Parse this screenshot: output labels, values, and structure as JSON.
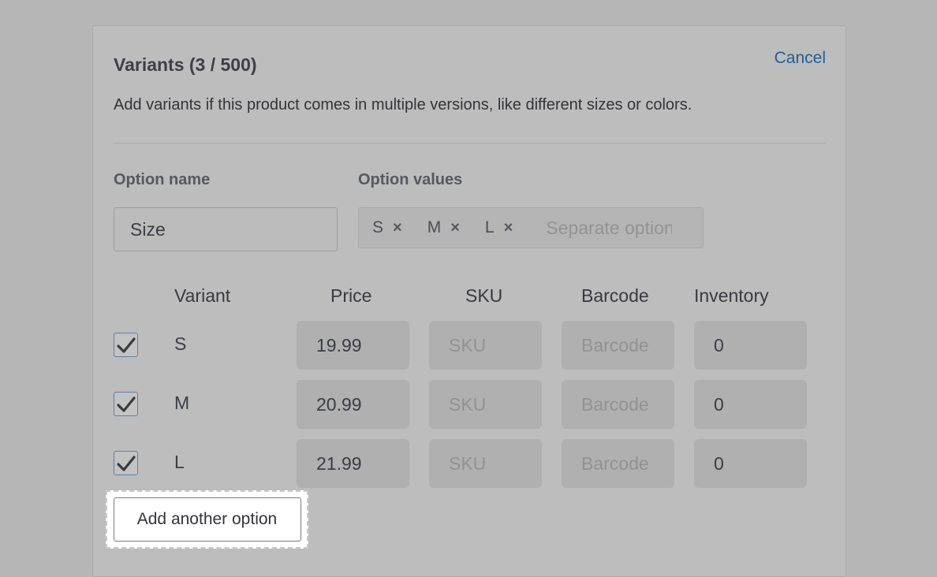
{
  "header": {
    "title": "Variants (3 / 500)",
    "cancel_label": "Cancel",
    "description": "Add variants if this product comes in multiple versions, like different sizes or colors."
  },
  "option": {
    "name_label": "Option name",
    "values_label": "Option values",
    "name_value": "Size",
    "values": [
      "S",
      "M",
      "L"
    ],
    "remove_glyph": "×",
    "values_placeholder": "Separate options with a comma"
  },
  "table": {
    "columns": [
      "Variant",
      "Price",
      "SKU",
      "Barcode",
      "Inventory"
    ],
    "rows": [
      {
        "checked": true,
        "variant": "S",
        "price": "19.99",
        "sku": "",
        "barcode": "",
        "inventory": "0"
      },
      {
        "checked": true,
        "variant": "M",
        "price": "20.99",
        "sku": "",
        "barcode": "",
        "inventory": "0"
      },
      {
        "checked": true,
        "variant": "L",
        "price": "21.99",
        "sku": "",
        "barcode": "",
        "inventory": "0"
      }
    ],
    "sku_placeholder": "SKU",
    "barcode_placeholder": "Barcode"
  },
  "actions": {
    "add_option_label": "Add another option"
  },
  "colors": {
    "accent_link": "#1f5f95",
    "overlay": "#b6b6b6",
    "highlight": "#ffffff"
  },
  "icons": {
    "checkbox": "checkmark-icon",
    "tag_remove": "close-icon"
  }
}
